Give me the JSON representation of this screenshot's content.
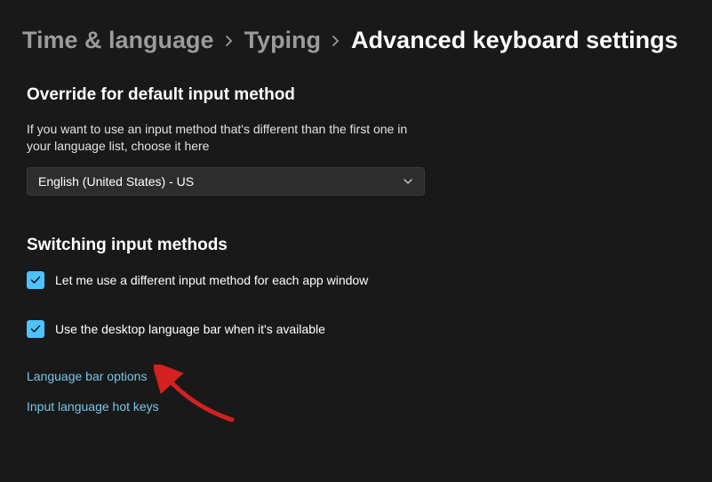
{
  "breadcrumb": {
    "level1": "Time & language",
    "level2": "Typing",
    "current": "Advanced keyboard settings"
  },
  "section1": {
    "title": "Override for default input method",
    "description": "If you want to use an input method that's different than the first one in your language list, choose it here",
    "dropdown_value": "English (United States) - US"
  },
  "section2": {
    "title": "Switching input methods",
    "checkbox1_label": "Let me use a different input method for each app window",
    "checkbox2_label": "Use the desktop language bar when it's available"
  },
  "links": {
    "language_bar": "Language bar options",
    "hotkeys": "Input language hot keys"
  }
}
